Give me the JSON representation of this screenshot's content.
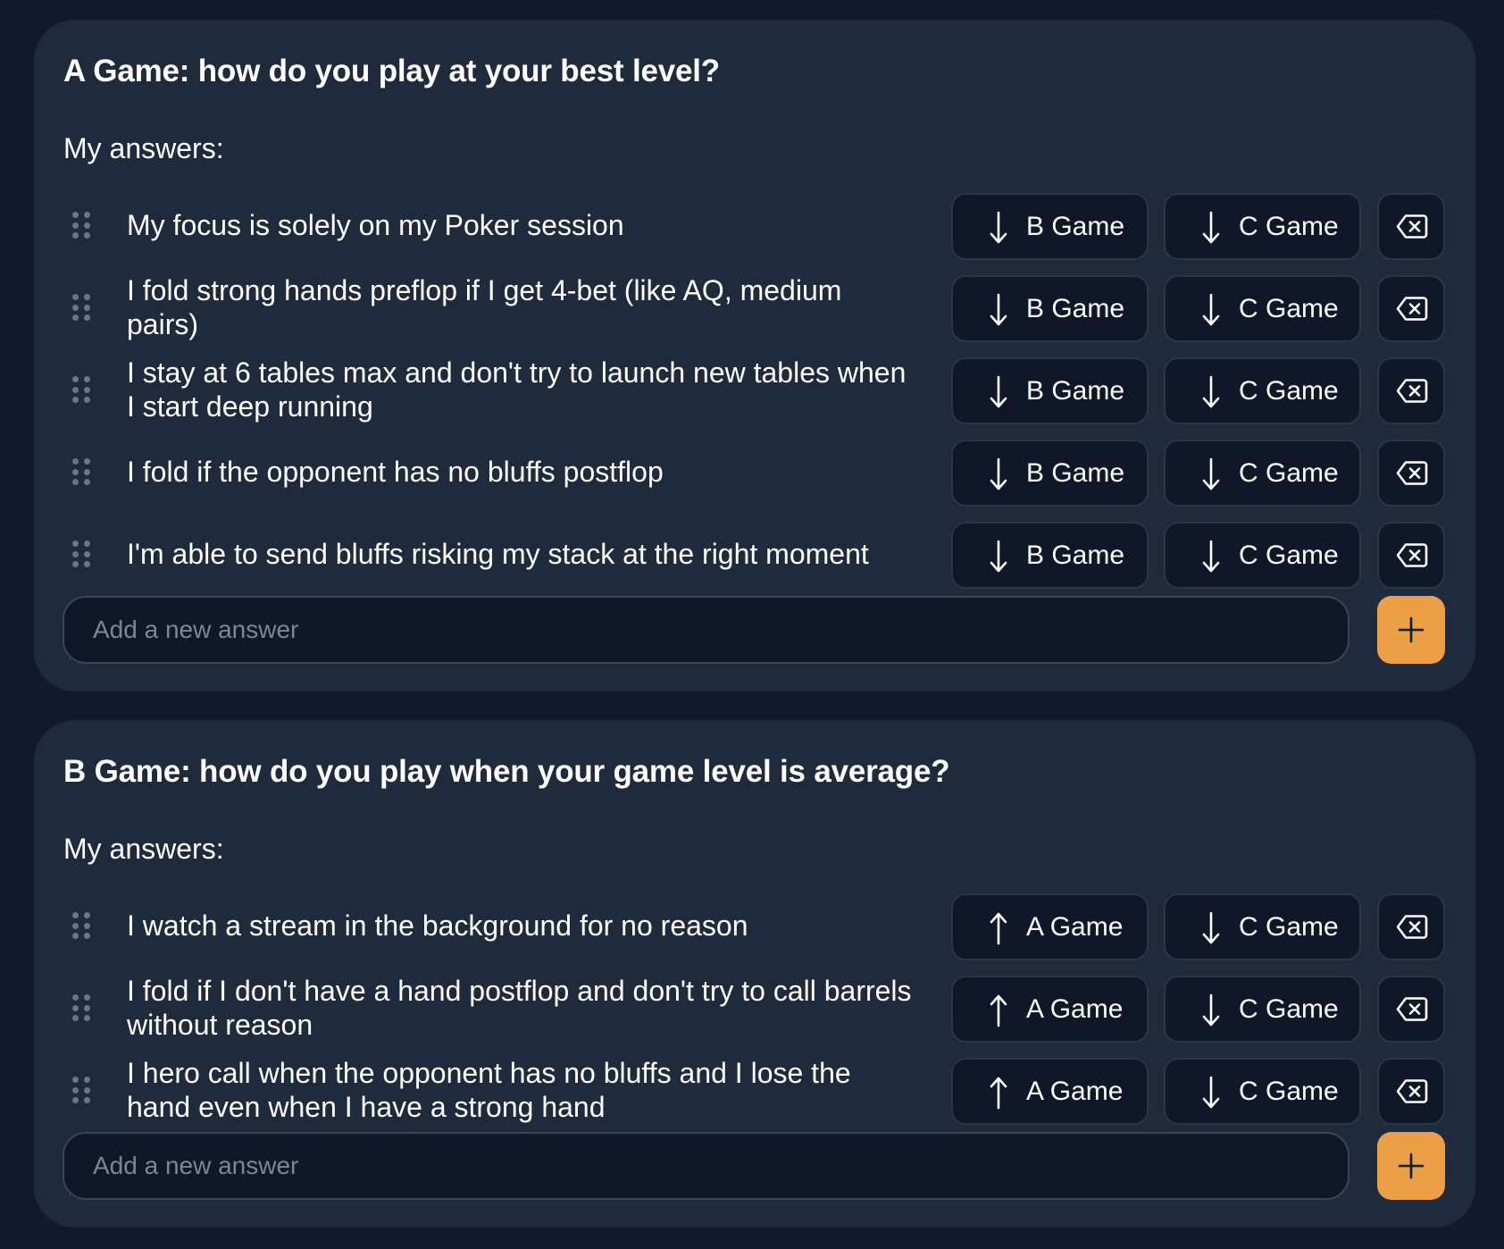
{
  "sections": [
    {
      "title": "A Game: how do you play at your best level?",
      "answers_label": "My answers:",
      "answers": [
        {
          "text": "My focus is solely on my Poker session",
          "move1": {
            "direction": "down",
            "label": "B Game"
          },
          "move2": {
            "direction": "down",
            "label": "C Game"
          }
        },
        {
          "text": "I fold strong hands preflop if I get 4-bet (like AQ, medium pairs)",
          "move1": {
            "direction": "down",
            "label": "B Game"
          },
          "move2": {
            "direction": "down",
            "label": "C Game"
          }
        },
        {
          "text": "I stay at 6 tables max and don't try to launch new tables when I start deep running",
          "move1": {
            "direction": "down",
            "label": "B Game"
          },
          "move2": {
            "direction": "down",
            "label": "C Game"
          }
        },
        {
          "text": "I fold if the opponent has no bluffs postflop",
          "move1": {
            "direction": "down",
            "label": "B Game"
          },
          "move2": {
            "direction": "down",
            "label": "C Game"
          }
        },
        {
          "text": "I'm able to send bluffs risking my stack at the right moment",
          "move1": {
            "direction": "down",
            "label": "B Game"
          },
          "move2": {
            "direction": "down",
            "label": "C Game"
          }
        }
      ],
      "add_placeholder": "Add a new answer"
    },
    {
      "title": "B Game: how do you play when your game level is average?",
      "answers_label": "My answers:",
      "answers": [
        {
          "text": "I watch a stream in the background for no reason",
          "move1": {
            "direction": "up",
            "label": "A Game"
          },
          "move2": {
            "direction": "down",
            "label": "C Game"
          }
        },
        {
          "text": "I fold if I don't have a hand postflop and don't try to call barrels without reason",
          "move1": {
            "direction": "up",
            "label": "A Game"
          },
          "move2": {
            "direction": "down",
            "label": "C Game"
          }
        },
        {
          "text": "I hero call when the opponent has no bluffs and I lose the hand even when I have a strong hand",
          "move1": {
            "direction": "up",
            "label": "A Game"
          },
          "move2": {
            "direction": "down",
            "label": "C Game"
          }
        }
      ],
      "add_placeholder": "Add a new answer"
    }
  ],
  "icons": {
    "drag": "drag-handle-icon",
    "move_down": "arrow-down-icon",
    "move_up": "arrow-up-icon",
    "delete": "backspace-icon",
    "add": "plus-icon"
  },
  "colors": {
    "background": "#111a2c",
    "card": "#1f2a3c",
    "button": "#0f1728",
    "button_border": "#2b3648",
    "accent": "#eb9f46",
    "text": "#ffffff",
    "placeholder": "#7d8696"
  }
}
